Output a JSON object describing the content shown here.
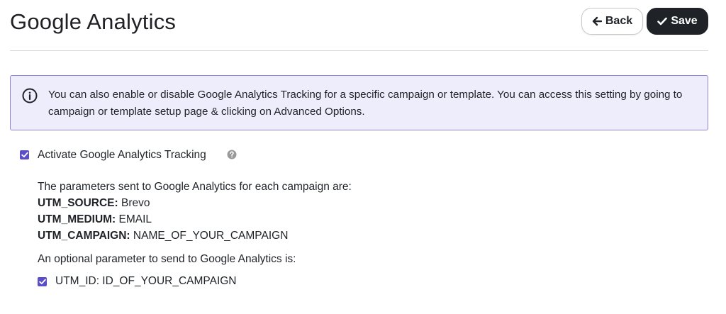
{
  "header": {
    "title": "Google Analytics",
    "back_label": "Back",
    "save_label": "Save"
  },
  "info": {
    "text": "You can also enable or disable Google Analytics Tracking for a specific campaign or template. You can access this setting by going to campaign or template setup page & clicking on Advanced Options."
  },
  "tracking": {
    "activate_label": "Activate Google Analytics Tracking",
    "activate_checked": true,
    "params_intro": "The parameters sent to Google Analytics for each campaign are:",
    "params": [
      {
        "key": "UTM_SOURCE:",
        "value": "Brevo"
      },
      {
        "key": "UTM_MEDIUM:",
        "value": "EMAIL"
      },
      {
        "key": "UTM_CAMPAIGN:",
        "value": "NAME_OF_YOUR_CAMPAIGN"
      }
    ],
    "optional_intro": "An optional parameter to send to Google Analytics is:",
    "utm_id_label": "UTM_ID: ID_OF_YOUR_CAMPAIGN",
    "utm_id_checked": true
  },
  "colors": {
    "accent": "#5b4fc9",
    "info_bg": "#eeedfb",
    "info_border": "#8f86d6",
    "primary_button": "#1f2328"
  },
  "icons": {
    "back": "arrow-left-icon",
    "save": "check-icon",
    "info": "info-circle-icon",
    "help": "question-circle-icon",
    "checkbox": "checkmark-icon"
  }
}
